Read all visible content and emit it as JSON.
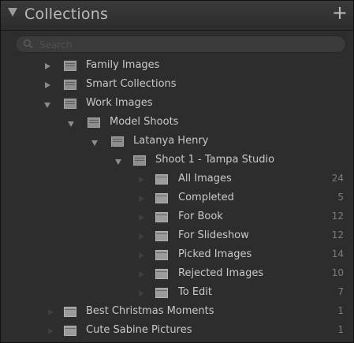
{
  "panel": {
    "title": "Collections",
    "add_label": "+",
    "search": {
      "placeholder": "Search"
    }
  },
  "tree": {
    "family": {
      "label": "Family Images"
    },
    "smart": {
      "label": "Smart Collections"
    },
    "work": {
      "label": "Work Images"
    },
    "model": {
      "label": "Model Shoots"
    },
    "latanya": {
      "label": "Latanya Henry"
    },
    "shoot1": {
      "label": "Shoot 1 - Tampa Studio"
    },
    "all_images": {
      "label": "All Images",
      "count": "24"
    },
    "completed": {
      "label": "Completed",
      "count": "5"
    },
    "for_book": {
      "label": "For Book",
      "count": "12"
    },
    "for_slideshow": {
      "label": "For Slideshow",
      "count": "12"
    },
    "picked": {
      "label": "Picked Images",
      "count": "14"
    },
    "rejected": {
      "label": "Rejected Images",
      "count": "10"
    },
    "to_edit": {
      "label": "To Edit",
      "count": "7"
    },
    "best_christmas": {
      "label": "Best Christmas Moments",
      "count": "1"
    },
    "cute_sabine": {
      "label": "Cute Sabine Pictures",
      "count": "1"
    }
  }
}
